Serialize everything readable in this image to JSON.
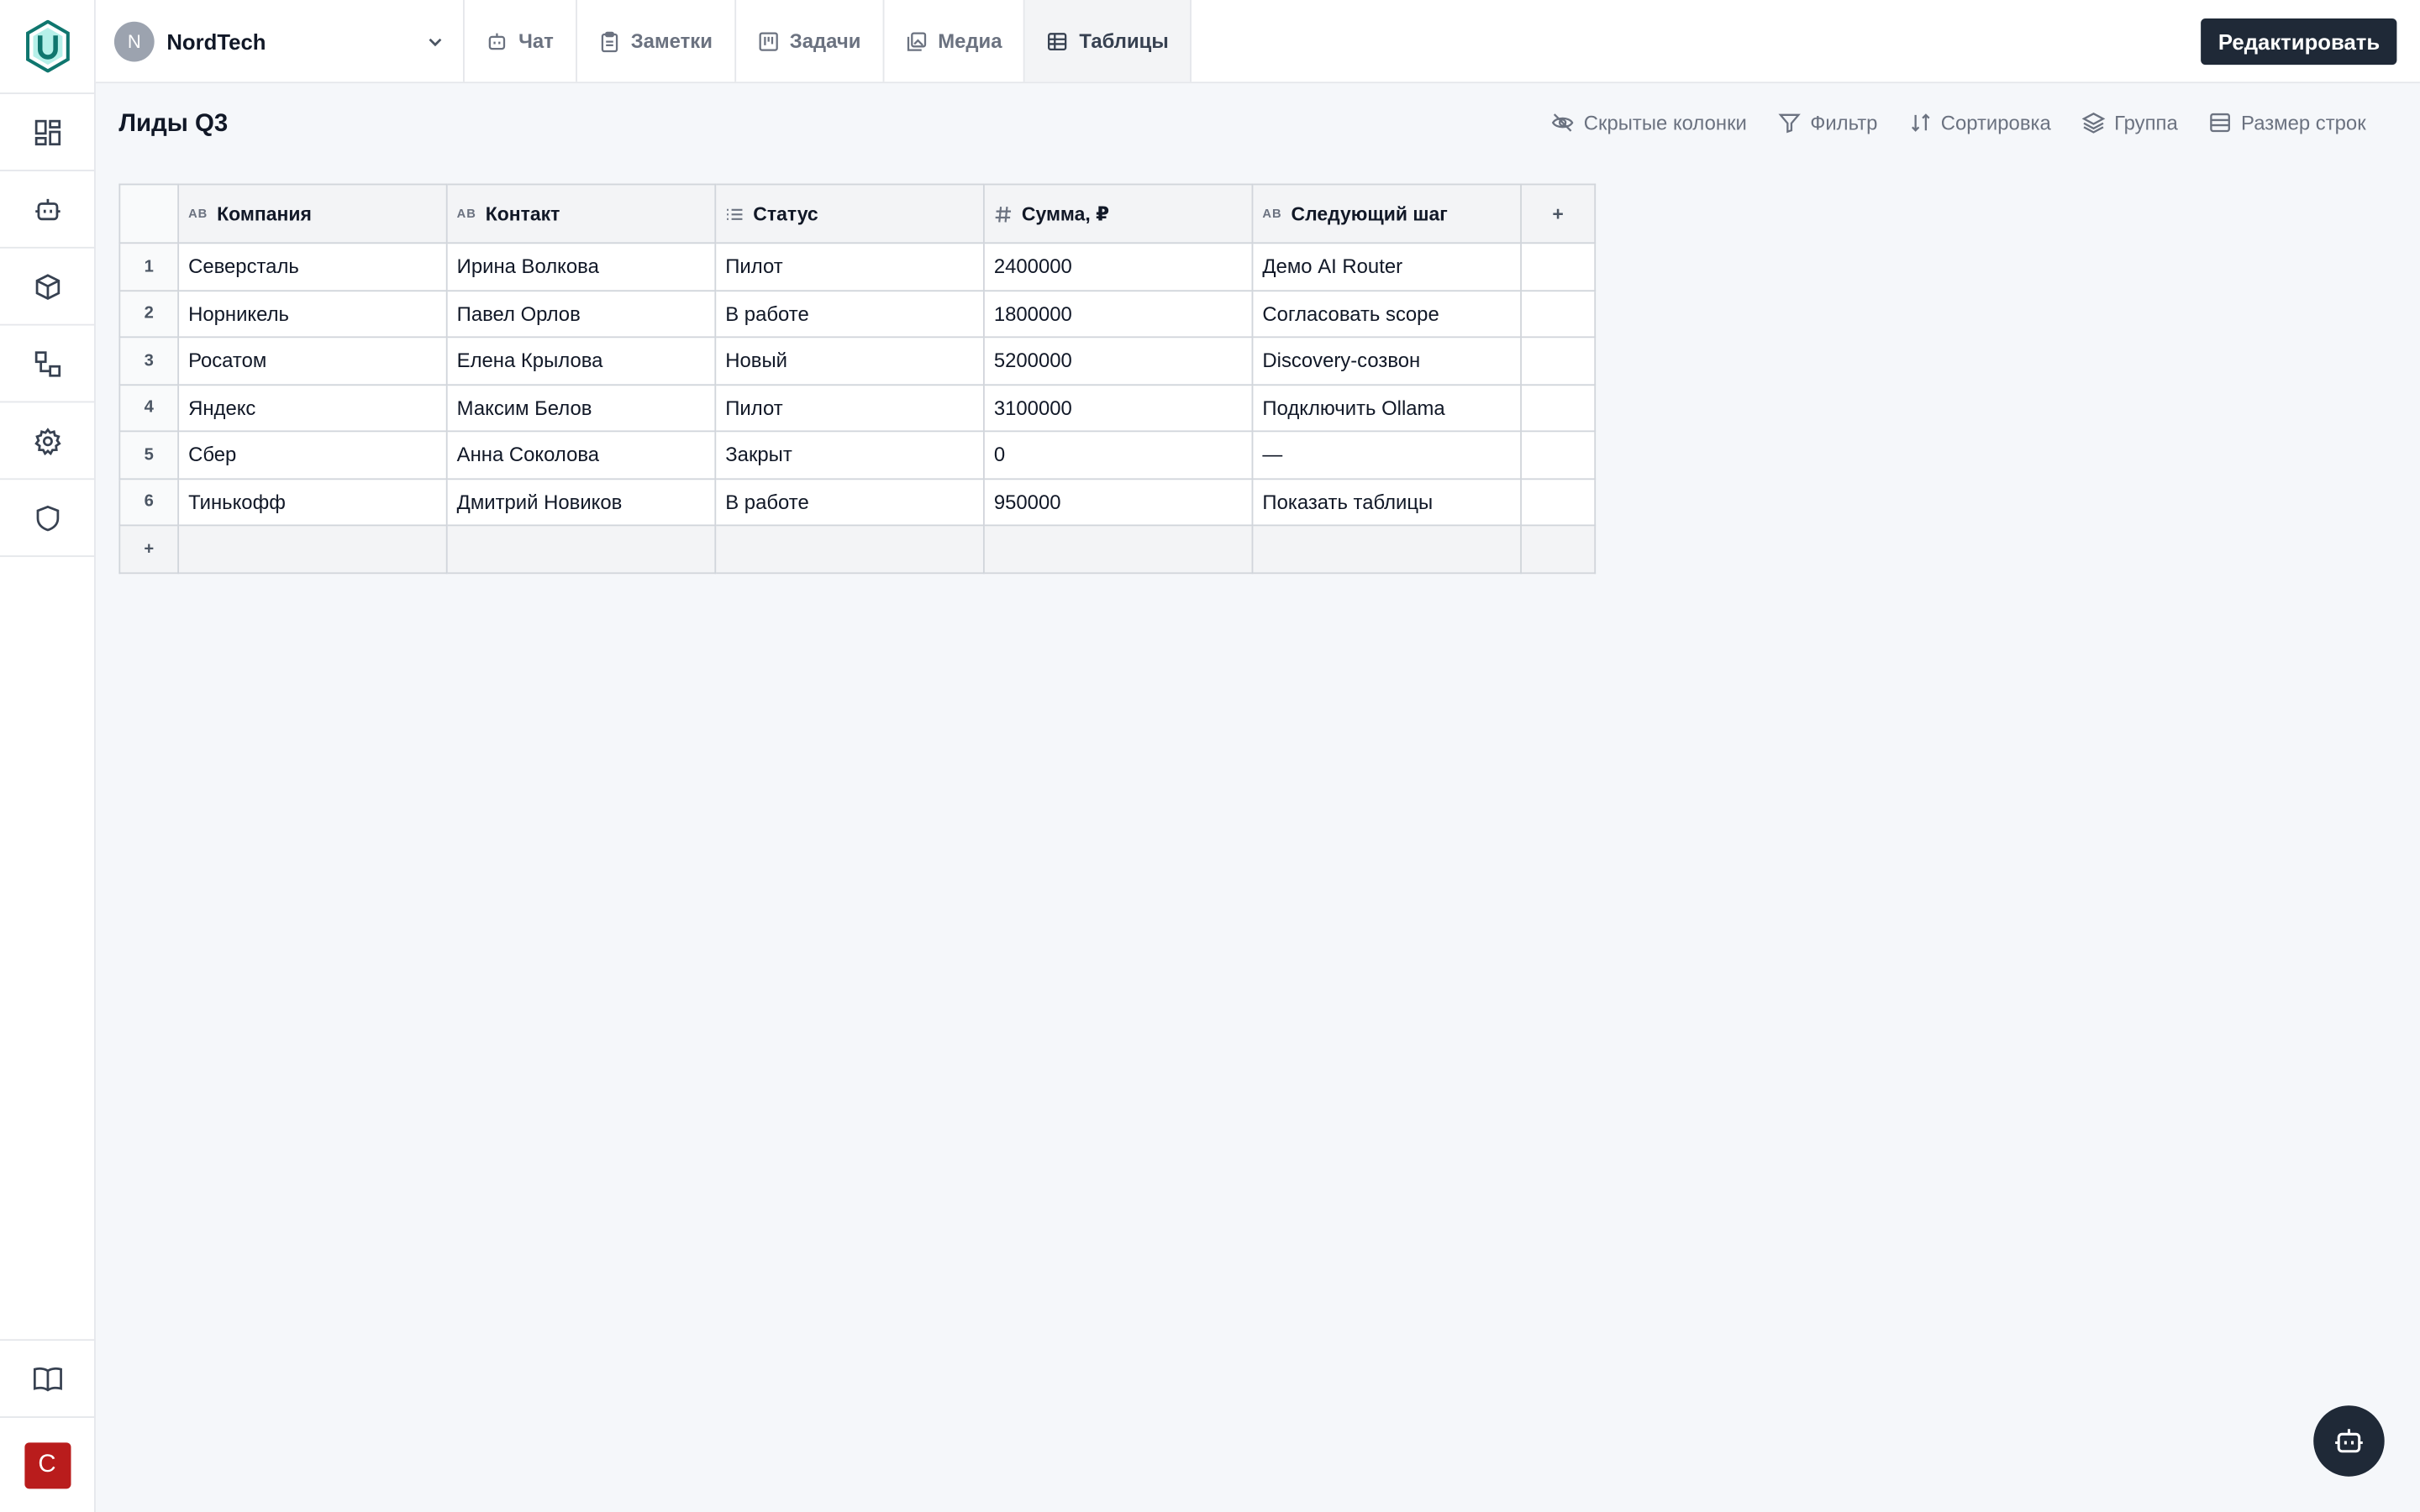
{
  "workspace": {
    "initial": "N",
    "name": "NordTech"
  },
  "tabs": [
    {
      "label": "Чат",
      "icon": "chat-bot-icon"
    },
    {
      "label": "Заметки",
      "icon": "notes-icon"
    },
    {
      "label": "Задачи",
      "icon": "kanban-icon"
    },
    {
      "label": "Медиа",
      "icon": "media-icon"
    },
    {
      "label": "Таблицы",
      "icon": "table-icon",
      "active": true
    }
  ],
  "edit_button": "Редактировать",
  "page_title": "Лиды Q3",
  "toolbar": {
    "hidden_columns": "Скрытые колонки",
    "filter": "Фильтр",
    "sort": "Сортировка",
    "group": "Группа",
    "row_size": "Размер строк"
  },
  "table": {
    "columns": [
      {
        "label": "Компания",
        "type": "AB"
      },
      {
        "label": "Контакт",
        "type": "AB"
      },
      {
        "label": "Статус",
        "type": "list"
      },
      {
        "label": "Сумма, ₽",
        "type": "number"
      },
      {
        "label": "Следующий шаг",
        "type": "AB"
      }
    ],
    "add_column": "+",
    "add_row": "+",
    "rows": [
      {
        "n": "1",
        "cells": [
          "Северсталь",
          "Ирина Волкова",
          "Пилот",
          "2400000",
          "Демо AI Router"
        ]
      },
      {
        "n": "2",
        "cells": [
          "Норникель",
          "Павел Орлов",
          "В работе",
          "1800000",
          "Согласовать scope"
        ]
      },
      {
        "n": "3",
        "cells": [
          "Росатом",
          "Елена Крылова",
          "Новый",
          "5200000",
          "Discovery-созвон"
        ]
      },
      {
        "n": "4",
        "cells": [
          "Яндекс",
          "Максим Белов",
          "Пилот",
          "3100000",
          "Подключить Ollama"
        ]
      },
      {
        "n": "5",
        "cells": [
          "Сбер",
          "Анна Соколова",
          "Закрыт",
          "0",
          "—"
        ]
      },
      {
        "n": "6",
        "cells": [
          "Тинькофф",
          "Дмитрий Новиков",
          "В работе",
          "950000",
          "Показать таблицы"
        ]
      }
    ]
  },
  "user_avatar": "C",
  "colors": {
    "accent": "#1f2937",
    "logo": "#0f766e",
    "user_avatar": "#b91c1c"
  }
}
